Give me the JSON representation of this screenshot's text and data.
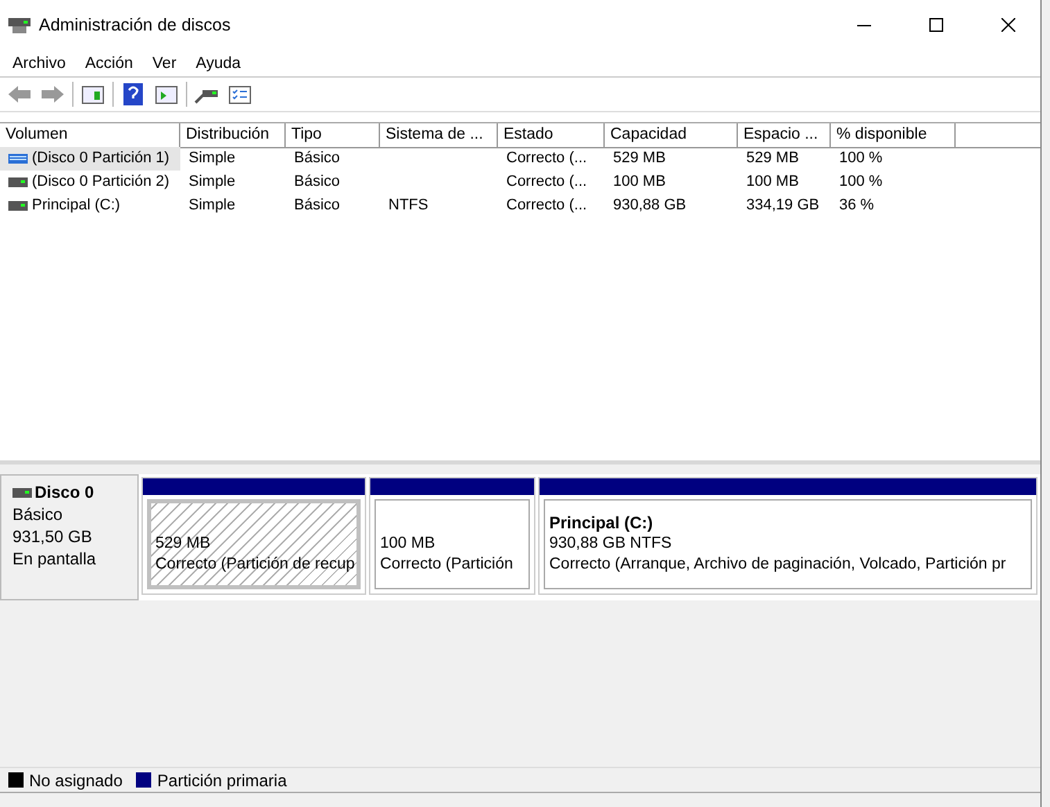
{
  "window": {
    "title": "Administración de discos"
  },
  "menu": [
    "Archivo",
    "Acción",
    "Ver",
    "Ayuda"
  ],
  "table": {
    "columns": [
      "Volumen",
      "Distribución",
      "Tipo",
      "Sistema de ...",
      "Estado",
      "Capacidad",
      "Espacio ...",
      "% disponible"
    ],
    "rows": [
      {
        "kind": "recovery",
        "selected": true,
        "cells": [
          "(Disco 0 Partición 1)",
          "Simple",
          "Básico",
          "",
          "Correcto (...",
          "529 MB",
          "529 MB",
          "100 %"
        ]
      },
      {
        "kind": "standard",
        "selected": false,
        "cells": [
          "(Disco 0 Partición 2)",
          "Simple",
          "Básico",
          "",
          "Correcto (...",
          "100 MB",
          "100 MB",
          "100 %"
        ]
      },
      {
        "kind": "standard",
        "selected": false,
        "cells": [
          "Principal (C:)",
          "Simple",
          "Básico",
          "NTFS",
          "Correcto (...",
          "930,88 GB",
          "334,19 GB",
          "36 %"
        ]
      }
    ]
  },
  "disk": {
    "name": "Disco 0",
    "type": "Básico",
    "size": "931,50 GB",
    "status": "En pantalla",
    "partitions": [
      {
        "selected": true,
        "size": "529 MB",
        "status": "Correcto (Partición de recup"
      },
      {
        "selected": false,
        "size": "100 MB",
        "status": "Correcto (Partición"
      },
      {
        "selected": false,
        "title": "Principal  (C:)",
        "size": "930,88 GB NTFS",
        "status": "Correcto (Arranque, Archivo de paginación, Volcado, Partición pr"
      }
    ]
  },
  "legend": [
    {
      "label": "No asignado",
      "color": "#000000"
    },
    {
      "label": "Partición primaria",
      "color": "#000080"
    }
  ]
}
